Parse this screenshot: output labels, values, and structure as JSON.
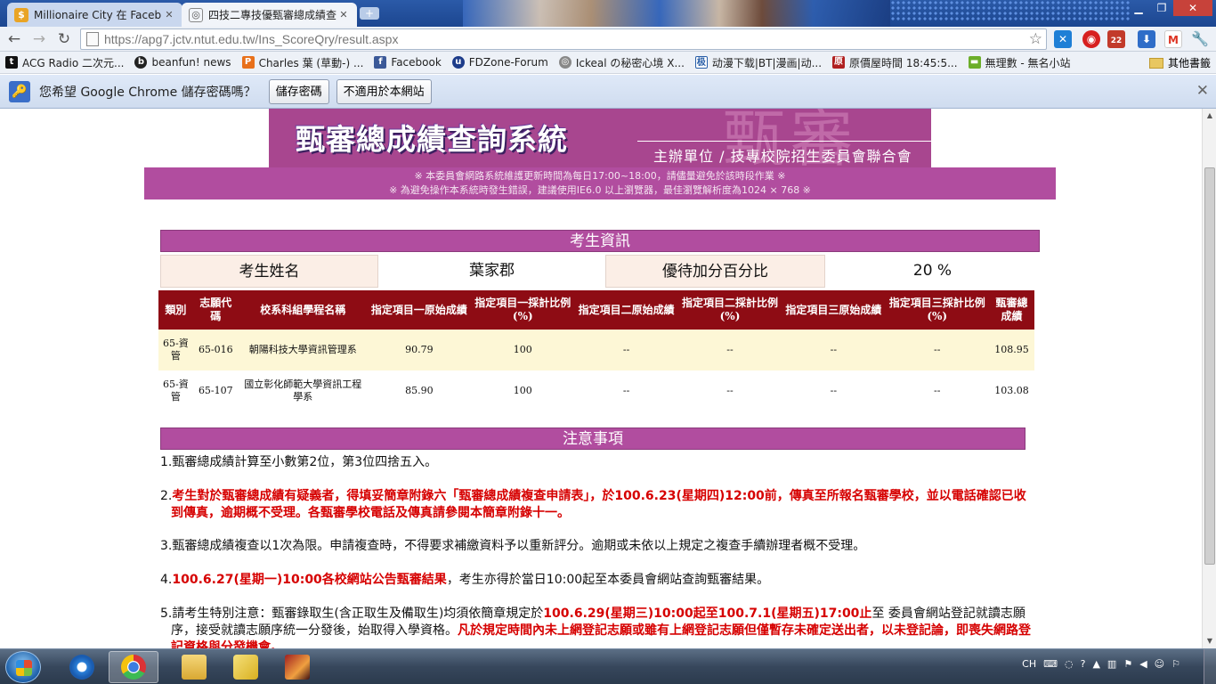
{
  "browser": {
    "tabs": [
      {
        "label": "Millionaire City 在 Faceb",
        "icon": "dollar-icon"
      },
      {
        "label": "四技二專技優甄審總成績查",
        "icon": "globe-icon"
      }
    ],
    "url": "https://apg7.jctv.ntut.edu.tw/Ins_ScoreQry/result.aspx",
    "bookmarks": [
      "ACG Radio 二次元...",
      "beanfun! news",
      "Charles 葉 (草動-) ...",
      "Facebook",
      "FDZone-Forum",
      "Ickeal の秘密心境 X...",
      "动漫下载|BT|漫画|动...",
      "原價屋時間 18:45:5...",
      "無理數 - 無名小站"
    ],
    "other_bookmarks": "其他書籤",
    "ext_badge": "22"
  },
  "password_bar": {
    "message": "您希望 Google Chrome 儲存密碼嗎？",
    "save_label": "儲存密碼",
    "never_label": "不適用於本網站"
  },
  "page": {
    "title": "甄審總成績查詢系統",
    "host": "主辦單位 / 技專校院招生委員會聯合會",
    "notice1": "※ 本委員會網路系統維護更新時間為每日17:00~18:00，請儘量避免於該時段作業 ※",
    "notice2": "※ 為避免操作本系統時發生錯誤，建議使用IE6.0 以上瀏覽器，最佳瀏覽解析度為1024 × 768 ※",
    "section_info": "考生資訊",
    "name_label": "考生姓名",
    "name_value": "葉家郡",
    "bonus_label": "優待加分百分比",
    "bonus_value": "20 %",
    "table": {
      "headers": [
        "類別",
        "志願代碼",
        "校系科組學程名稱",
        "指定項目一原始成績",
        "指定項目一採計比例(%)",
        "指定項目二原始成績",
        "指定項目二採計比例(%)",
        "指定項目三原始成績",
        "指定項目三採計比例(%)",
        "甄審總成績"
      ],
      "rows": [
        [
          "65-資管",
          "65-016",
          "朝陽科技大學資訊管理系",
          "90.79",
          "100",
          "--",
          "--",
          "--",
          "--",
          "108.95"
        ],
        [
          "65-資管",
          "65-107",
          "國立彰化師範大學資訊工程學系",
          "85.90",
          "100",
          "--",
          "--",
          "--",
          "--",
          "103.08"
        ]
      ]
    },
    "section_notes": "注意事項",
    "notes": {
      "n1": "1.甄審總成績計算至小數第2位，第3位四捨五入。",
      "n2_num": "2.",
      "n2_red": "考生對於甄審總成績有疑義者，得填妥簡章附錄六「甄審總成績複查申請表」，於100.6.23(星期四)12:00前，傳真至所報名甄審學校，並以電話確認已收到傳真，逾期概不受理。各甄審學校電話及傳真請參閱本簡章附錄十一。",
      "n3": "3.甄審總成績複查以1次為限。申請複查時，不得要求補繳資料予以重新評分。逾期或未依以上規定之複查手續辦理者概不受理。",
      "n4_num": "4.",
      "n4_red": "100.6.27(星期一)10:00各校網站公告甄審結果",
      "n4_rest": "，考生亦得於當日10:00起至本委員會網站查詢甄審結果。",
      "n5_a": "5.請考生特別注意：甄審錄取生(含正取生及備取生)均須依簡章規定於",
      "n5_red1": "100.6.29(星期三)10:00起至100.7.1(星期五)17:00止",
      "n5_b": "至 委員會網站登記就讀志願序，接受就讀志願序統一分發後，始取得入學資格。",
      "n5_red2": "凡於規定時間內未上網登記志願或雖有上網登記志願但僅暫存未確定送出者，以未登記論，即喪失網路登記資格與分發機會。"
    }
  },
  "taskbar": {
    "lang": "CH"
  },
  "colors": {
    "banner": "#a8468f",
    "section": "#b14d9f",
    "table_header": "#8e0c14",
    "emphasis": "#d60000"
  }
}
